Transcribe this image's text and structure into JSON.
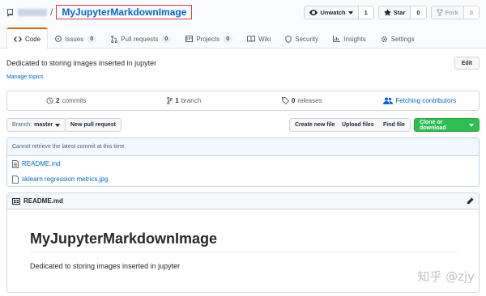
{
  "repo": {
    "name": "MyJupyterMarkdownImage",
    "separator": "/"
  },
  "actions": {
    "unwatch": {
      "label": "Unwatch",
      "count": "1"
    },
    "star": {
      "label": "Star",
      "count": "0"
    },
    "fork": {
      "label": "Fork",
      "count": "0"
    }
  },
  "tabs": [
    {
      "label": "Code",
      "icon": "code-icon",
      "selected": true
    },
    {
      "label": "Issues",
      "count": "0",
      "icon": "issue-icon"
    },
    {
      "label": "Pull requests",
      "count": "0",
      "icon": "pull-request-icon"
    },
    {
      "label": "Projects",
      "count": "0",
      "icon": "project-icon"
    },
    {
      "label": "Wiki",
      "icon": "book-icon"
    },
    {
      "label": "Security",
      "icon": "shield-icon"
    },
    {
      "label": "Insights",
      "icon": "graph-icon"
    },
    {
      "label": "Settings",
      "icon": "gear-icon"
    }
  ],
  "description": "Dedicated to storing images inserted in jupyter",
  "manage_topics": "Manage topics",
  "edit_label": "Edit",
  "summary": {
    "commits_count": "2",
    "commits_label": "commits",
    "branch_count": "1",
    "branch_label": "branch",
    "releases_count": "0",
    "releases_label": "releases",
    "contributors_label": "Fetching contributors"
  },
  "filenav": {
    "branch_prefix": "Branch:",
    "branch_name": "master",
    "new_pull_request": "New pull request",
    "create_new_file": "Create new file",
    "upload_files": "Upload files",
    "find_file": "Find file",
    "clone_download": "Clone or download"
  },
  "commit_tease": "Cannot retrieve the latest commit at this time.",
  "files": [
    {
      "name": "README.md"
    },
    {
      "name": "sklearn regression metrics.jpg"
    }
  ],
  "readme": {
    "header": "README.md",
    "title": "MyJupyterMarkdownImage",
    "body": "Dedicated to storing images inserted in jupyter"
  },
  "watermark": "知乎 @zjy",
  "colors": {
    "link": "#0366d6",
    "accent_tab": "#e36209",
    "green_button": "#2cbe4e",
    "highlight_box": "#d73a49"
  }
}
